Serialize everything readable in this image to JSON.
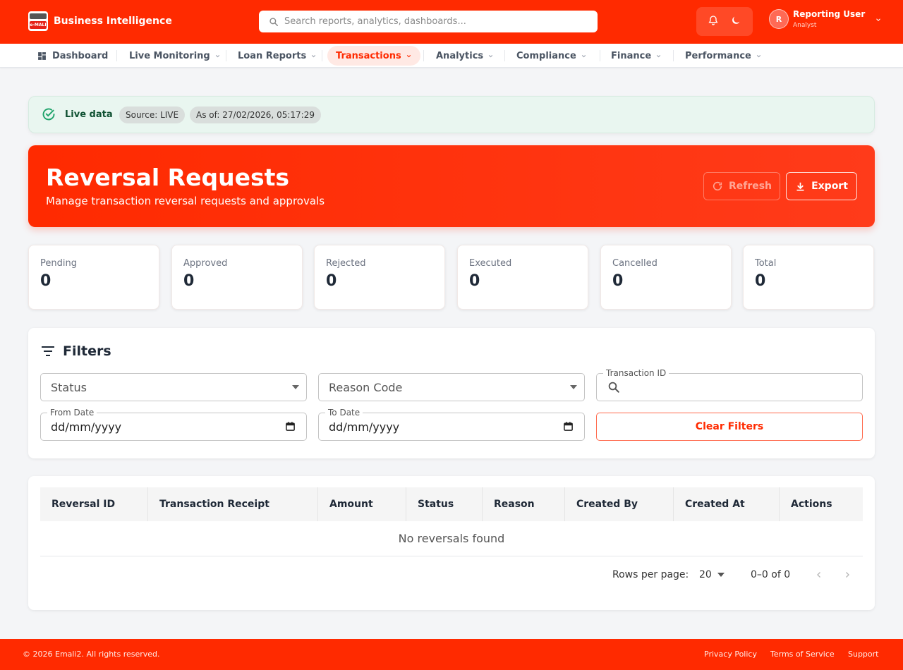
{
  "header": {
    "brand_name": "Business Intelligence",
    "logo_text": "e-MALI",
    "search_placeholder": "Search reports, analytics, dashboards...",
    "user_name": "Reporting User",
    "user_role": "Analyst",
    "user_initial": "R"
  },
  "nav": {
    "items": [
      {
        "label": "Dashboard"
      },
      {
        "label": "Live Monitoring"
      },
      {
        "label": "Loan Reports"
      },
      {
        "label": "Transactions"
      },
      {
        "label": "Analytics"
      },
      {
        "label": "Compliance"
      },
      {
        "label": "Finance"
      },
      {
        "label": "Performance"
      }
    ],
    "active": "Transactions"
  },
  "live_banner": {
    "label": "Live data",
    "source": "Source: LIVE",
    "as_of": "As of: 27/02/2026, 05:17:29"
  },
  "hero": {
    "title": "Reversal Requests",
    "subtitle": "Manage transaction reversal requests and approvals",
    "refresh_label": "Refresh",
    "export_label": "Export"
  },
  "stats": [
    {
      "label": "Pending",
      "value": "0"
    },
    {
      "label": "Approved",
      "value": "0"
    },
    {
      "label": "Rejected",
      "value": "0"
    },
    {
      "label": "Executed",
      "value": "0"
    },
    {
      "label": "Cancelled",
      "value": "0"
    },
    {
      "label": "Total",
      "value": "0"
    }
  ],
  "filters": {
    "title": "Filters",
    "status_placeholder": "Status",
    "reason_placeholder": "Reason Code",
    "transaction_id_label": "Transaction ID",
    "from_date_label": "From Date",
    "from_date_value": "dd/mm/yyyy",
    "to_date_label": "To Date",
    "to_date_value": "dd/mm/yyyy",
    "clear_label": "Clear Filters"
  },
  "table": {
    "columns": [
      "Reversal ID",
      "Transaction Receipt",
      "Amount",
      "Status",
      "Reason",
      "Created By",
      "Created At",
      "Actions"
    ],
    "empty_text": "No reversals found",
    "rows_per_page_label": "Rows per page:",
    "rows_per_page_value": "20",
    "range_text": "0–0 of 0"
  },
  "footer": {
    "copyright": "© 2026 Emali2. All rights reserved.",
    "links": [
      "Privacy Policy",
      "Terms of Service",
      "Support"
    ]
  },
  "colors": {
    "brand": "#ff2a00",
    "live_bg": "#e9f6f0",
    "live_icon": "#1fa36b"
  }
}
